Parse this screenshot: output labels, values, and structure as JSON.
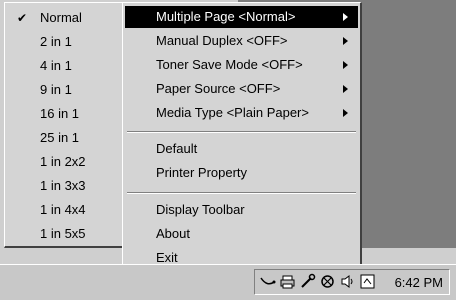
{
  "submenu": {
    "items": [
      {
        "label": "Normal",
        "checked": true
      },
      {
        "label": "2 in 1"
      },
      {
        "label": "4 in 1"
      },
      {
        "label": "9 in 1"
      },
      {
        "label": "16 in 1"
      },
      {
        "label": "25 in 1"
      },
      {
        "label": "1 in 2x2"
      },
      {
        "label": "1 in 3x3"
      },
      {
        "label": "1 in 4x4"
      },
      {
        "label": "1 in 5x5"
      }
    ]
  },
  "menu": {
    "items": [
      {
        "label": "Multiple Page <Normal>",
        "has_submenu": true,
        "highlighted": true
      },
      {
        "label": "Manual Duplex <OFF>",
        "has_submenu": true
      },
      {
        "label": "Toner Save Mode <OFF>",
        "has_submenu": true
      },
      {
        "label": "Paper Source <OFF>",
        "has_submenu": true
      },
      {
        "label": "Media Type <Plain Paper>",
        "has_submenu": true
      },
      {
        "label": "Default"
      },
      {
        "label": "Printer Property"
      },
      {
        "label": "Display Toolbar"
      },
      {
        "label": "About"
      },
      {
        "label": "Exit"
      }
    ]
  },
  "tray": {
    "icons": [
      "network-icon",
      "printer-icon",
      "tool-icon",
      "status-icon",
      "speaker-icon",
      "printer-status-icon"
    ],
    "clock": "6:42 PM"
  },
  "colors": {
    "menu_bg": "#d4d4d4",
    "highlight_bg": "#000000",
    "highlight_text": "#ffffff",
    "desktop_dark": "#7d7d7d"
  }
}
